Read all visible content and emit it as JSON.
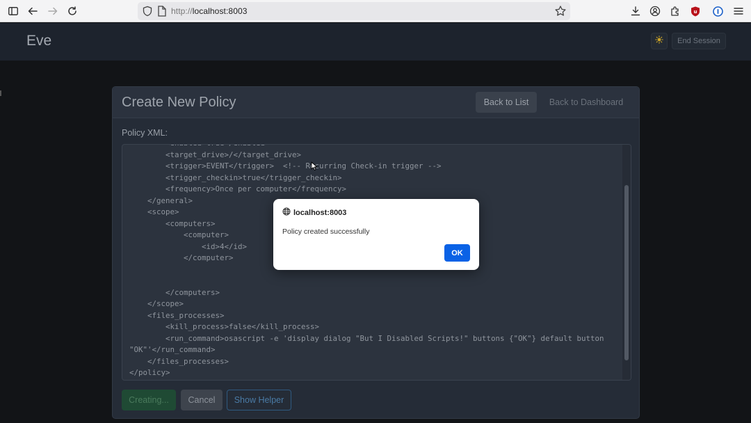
{
  "browser": {
    "url_scheme": "http://",
    "url_host": "localhost:8003",
    "icons": [
      "sidebar-icon",
      "back-icon",
      "forward-icon",
      "reload-icon",
      "shield-icon",
      "page-icon",
      "bookmark-star-icon",
      "download-icon",
      "account-icon",
      "extensions-icon",
      "ublock-icon",
      "password-manager-icon",
      "menu-icon"
    ]
  },
  "app": {
    "brand": "Eve",
    "end_session_label": "End Session",
    "theme_icon": "sun-icon"
  },
  "card": {
    "title": "Create New Policy",
    "back_to_list": "Back to List",
    "back_to_dashboard": "Back to Dashboard",
    "field_label": "Policy XML:"
  },
  "editor": {
    "lines": [
      "        <enabled>true</enabled>",
      "        <target_drive>/</target_drive>",
      "        <trigger>EVENT</trigger>  <!-- Recurring Check-in trigger -->",
      "        <trigger_checkin>true</trigger_checkin>",
      "        <frequency>Once per computer</frequency>",
      "    </general>",
      "    <scope>",
      "        <computers>",
      "            <computer>",
      "                <id>4</id>",
      "            </computer>",
      "",
      "",
      "        </computers>",
      "    </scope>",
      "    <files_processes>",
      "        <kill_process>false</kill_process>",
      "        <run_command>osascript -e 'display dialog \"But I Disabled Scripts!\" buttons {\"OK\"} default button",
      "\"OK\"'</run_command>",
      "    </files_processes>",
      "</policy>"
    ]
  },
  "actions": {
    "creating_label": "Creating...",
    "cancel_label": "Cancel",
    "helper_label": "Show Helper"
  },
  "dialog": {
    "origin": "localhost:8003",
    "message": "Policy created successfully",
    "ok_label": "OK"
  },
  "colors": {
    "ok_button": "#0a62e6",
    "header_bg": "#1d232d",
    "card_bg": "#252c37"
  }
}
